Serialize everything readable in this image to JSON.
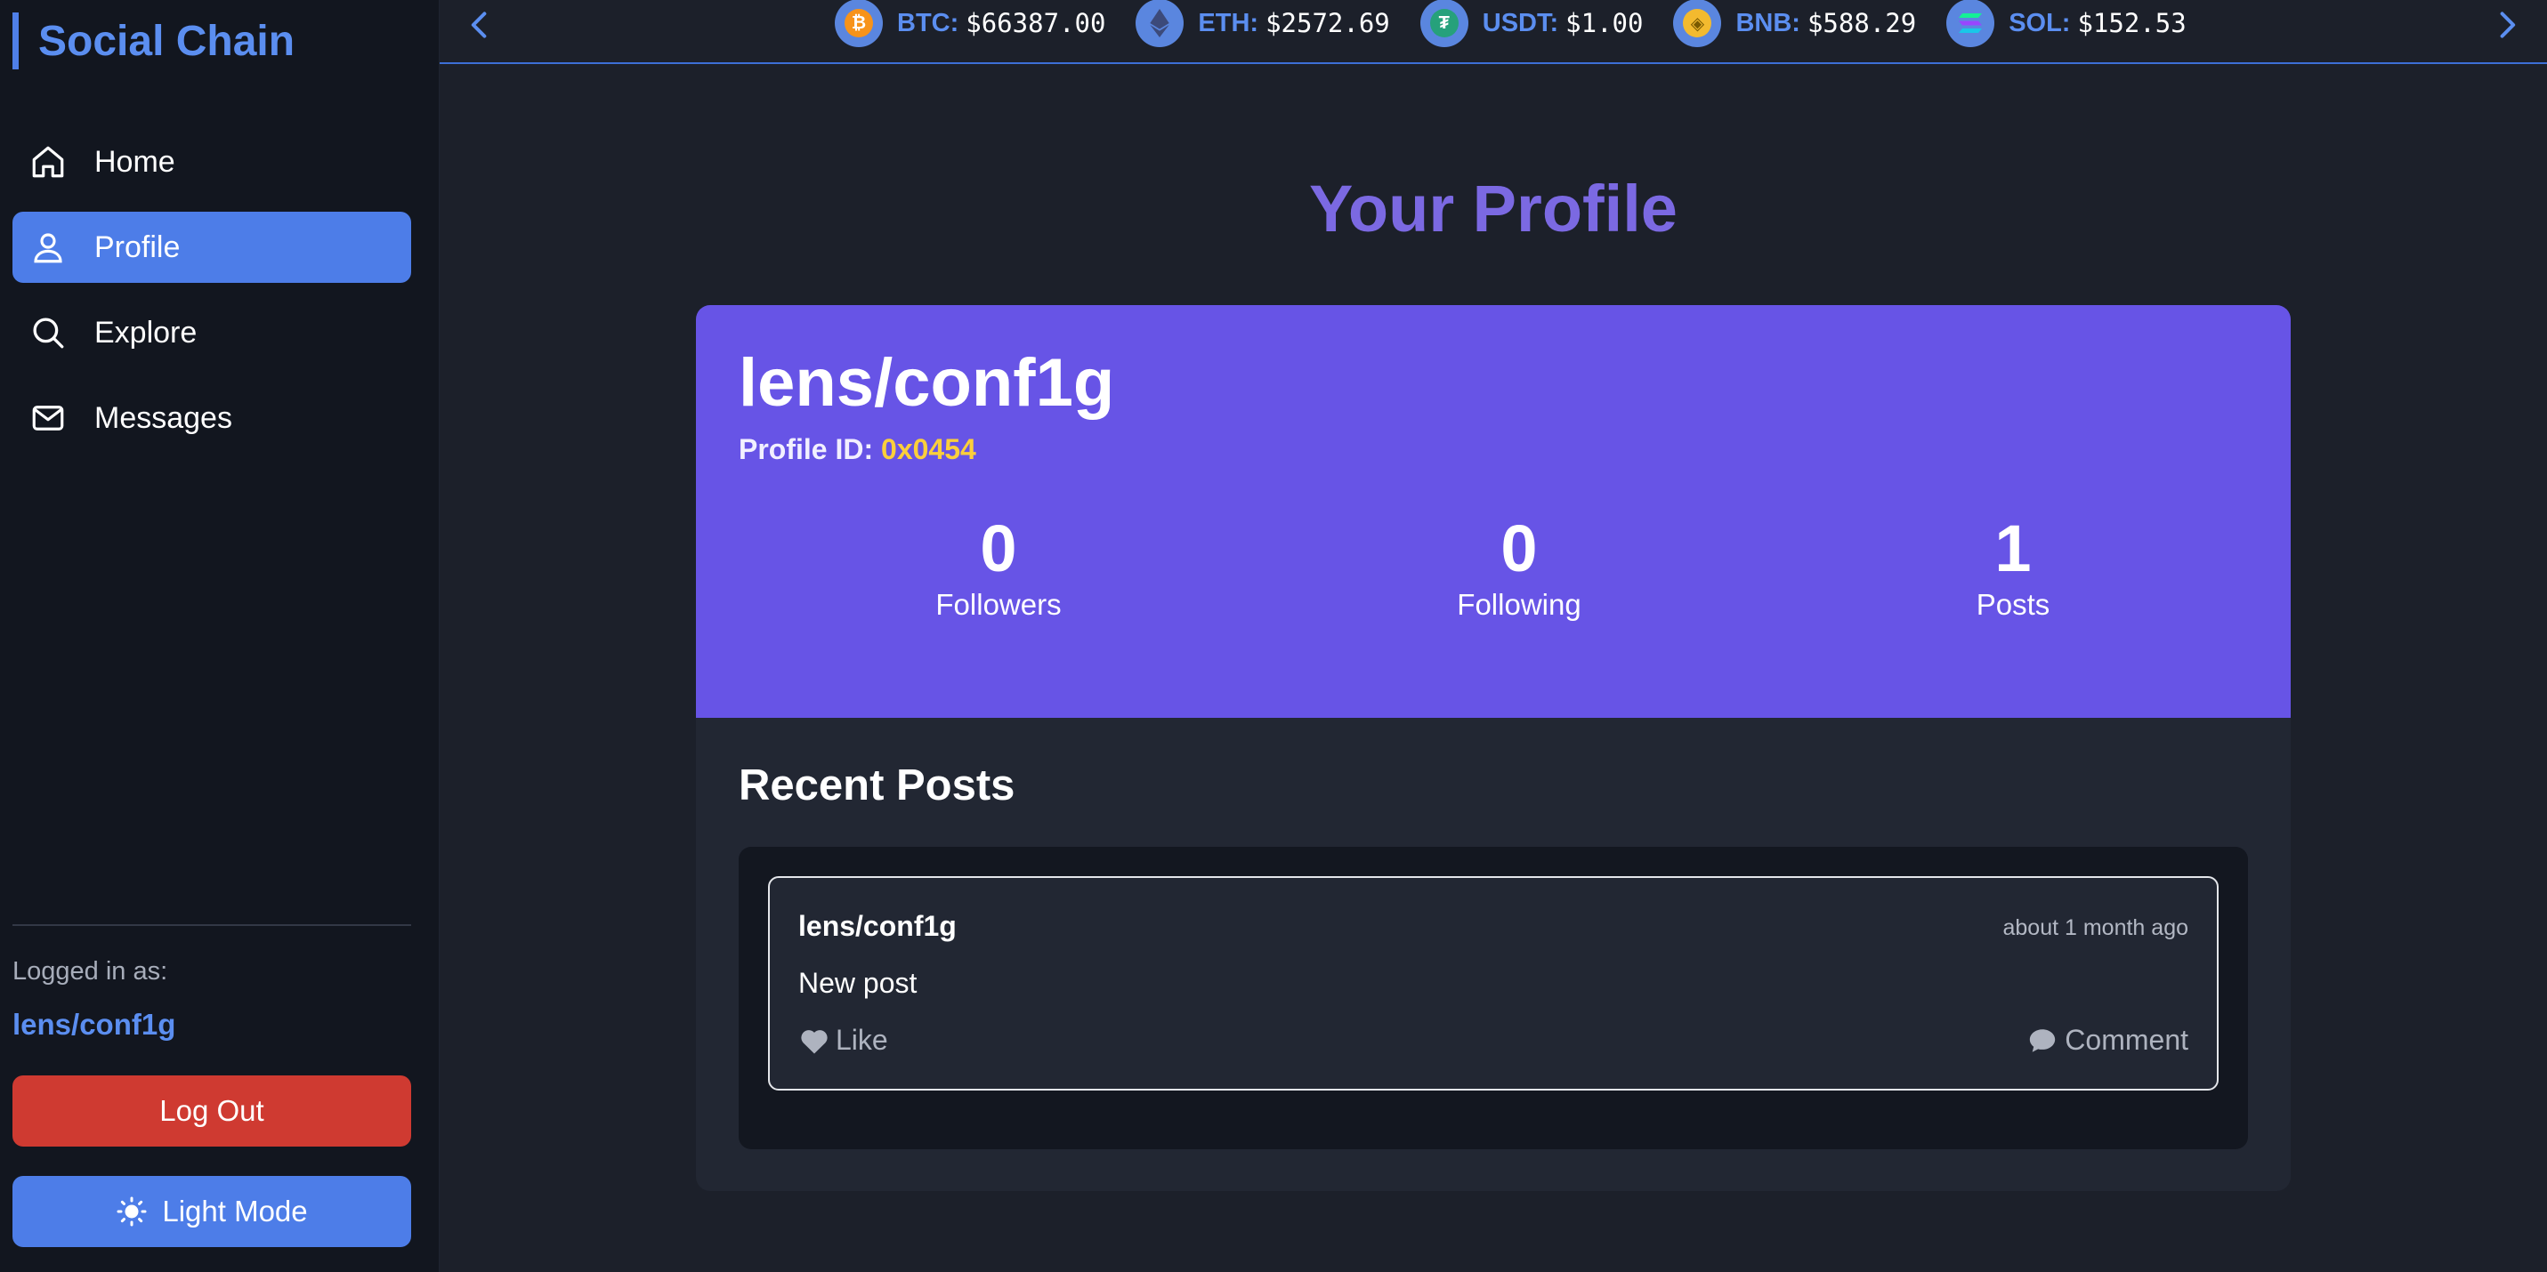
{
  "app": {
    "brand": "Social Chain"
  },
  "sidebar": {
    "items": [
      {
        "label": "Home",
        "icon": "home-icon"
      },
      {
        "label": "Profile",
        "icon": "user-icon",
        "active": true
      },
      {
        "label": "Explore",
        "icon": "search-icon"
      },
      {
        "label": "Messages",
        "icon": "mail-icon"
      }
    ],
    "logged_in_label": "Logged in as:",
    "logged_in_user": "lens/conf1g",
    "logout_label": "Log Out",
    "theme_toggle_label": "Light Mode"
  },
  "ticker": {
    "coins": [
      {
        "symbol": "BTC:",
        "price": "$66387.00",
        "icon": "bitcoin-icon",
        "color": "#f7931a"
      },
      {
        "symbol": "ETH:",
        "price": "$2572.69",
        "icon": "ethereum-icon",
        "color": "#627eea"
      },
      {
        "symbol": "USDT:",
        "price": "$1.00",
        "icon": "tether-icon",
        "color": "#26a17b"
      },
      {
        "symbol": "BNB:",
        "price": "$588.29",
        "icon": "bnb-icon",
        "color": "#f3ba2f"
      },
      {
        "symbol": "SOL:",
        "price": "$152.53",
        "icon": "solana-icon",
        "color": "#9945ff"
      }
    ]
  },
  "main": {
    "title": "Your Profile",
    "profile": {
      "handle": "lens/conf1g",
      "id_label": "Profile ID:",
      "id_value": "0x0454",
      "stats": [
        {
          "value": "0",
          "label": "Followers"
        },
        {
          "value": "0",
          "label": "Following"
        },
        {
          "value": "1",
          "label": "Posts"
        }
      ]
    },
    "recent_posts_title": "Recent Posts",
    "posts": [
      {
        "author": "lens/conf1g",
        "time": "about 1 month ago",
        "body": "New post",
        "like_label": "Like",
        "comment_label": "Comment"
      }
    ]
  },
  "colors": {
    "accent": "#4d7de8",
    "profile_header": "#6754e6",
    "title": "#7b69e2",
    "profile_id": "#fbcf3b",
    "logout": "#cf3a31"
  }
}
